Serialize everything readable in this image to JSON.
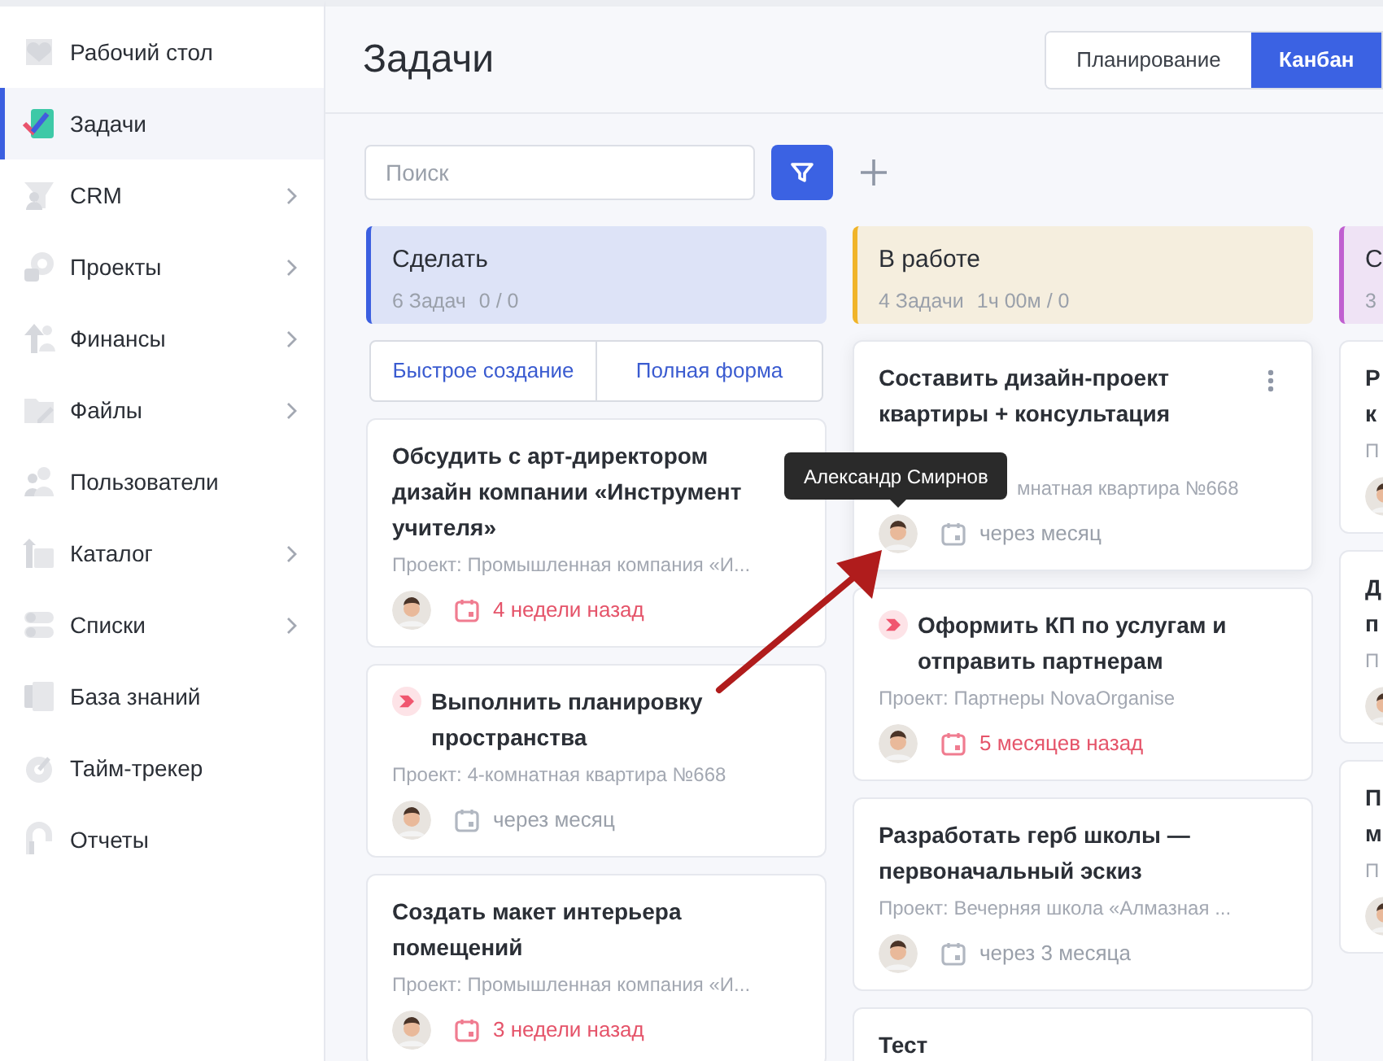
{
  "sidebar": {
    "items": [
      {
        "label": "Рабочий стол",
        "submenu": false,
        "selected": false
      },
      {
        "label": "Задачи",
        "submenu": false,
        "selected": true
      },
      {
        "label": "CRM",
        "submenu": true,
        "selected": false
      },
      {
        "label": "Проекты",
        "submenu": true,
        "selected": false
      },
      {
        "label": "Финансы",
        "submenu": true,
        "selected": false
      },
      {
        "label": "Файлы",
        "submenu": true,
        "selected": false
      },
      {
        "label": "Пользователи",
        "submenu": false,
        "selected": false
      },
      {
        "label": "Каталог",
        "submenu": true,
        "selected": false
      },
      {
        "label": "Списки",
        "submenu": true,
        "selected": false
      },
      {
        "label": "База знаний",
        "submenu": false,
        "selected": false
      },
      {
        "label": "Тайм-трекер",
        "submenu": false,
        "selected": false
      },
      {
        "label": "Отчеты",
        "submenu": false,
        "selected": false
      }
    ]
  },
  "page": {
    "title": "Задачи",
    "views": [
      {
        "label": "Планирование",
        "selected": false
      },
      {
        "label": "Канбан",
        "selected": true
      }
    ]
  },
  "toolbar": {
    "search": {
      "placeholder": "Поиск"
    }
  },
  "columns": [
    {
      "title": "Сделать",
      "count": "6 Задач",
      "time": "0 / 0",
      "color": "#3b5fe0",
      "quick_buttons": [
        "Быстрое создание",
        "Полная форма"
      ],
      "cards": [
        {
          "title": "Обсудить с арт-директором дизайн компании «Инструмент учителя»",
          "priority": false,
          "project": "Проект: Промышленная компания «И...",
          "due": "4 недели назад",
          "overdue": true,
          "menu": false
        },
        {
          "title": "Выполнить планировку пространства",
          "priority": true,
          "project": "Проект: 4-комнатная квартира №668",
          "due": "через месяц",
          "overdue": false,
          "menu": false
        },
        {
          "title": "Создать макет интерьера помещений",
          "priority": false,
          "project": "Проект: Промышленная компания «И...",
          "due": "3 недели назад",
          "overdue": true,
          "menu": false
        }
      ]
    },
    {
      "title": "В работе",
      "count": "4 Задачи",
      "time": "1ч 00м / 0",
      "color": "#f0b429",
      "cards": [
        {
          "title": "Составить дизайн-проект квартиры + консультация",
          "priority": false,
          "project": "мнатная квартира №668",
          "due": "через месяц",
          "overdue": false,
          "menu": true
        },
        {
          "title": "Оформить КП по услугам и отправить партнерам",
          "priority": true,
          "project": "Проект: Партнеры NovaOrganise",
          "due": "5 месяцев назад",
          "overdue": true,
          "menu": false
        },
        {
          "title": "Разработать герб школы — первоначальный эскиз",
          "priority": false,
          "project": "Проект: Вечерняя школа «Алмазная ...",
          "due": "через 3 месяца",
          "overdue": false,
          "menu": false
        },
        {
          "title": "Тест",
          "priority": false,
          "menu": false
        }
      ]
    },
    {
      "title": "С",
      "count": "3",
      "color": "#c05fd0",
      "cards": [
        {
          "title": "Р к",
          "project": "П",
          "priority": false,
          "menu": false
        },
        {
          "title": "Д п",
          "project": "П",
          "priority": false,
          "menu": false
        },
        {
          "title": "П м",
          "project": "П",
          "priority": false,
          "menu": false
        }
      ]
    }
  ],
  "tooltip": {
    "text": "Александр Смирнов"
  }
}
